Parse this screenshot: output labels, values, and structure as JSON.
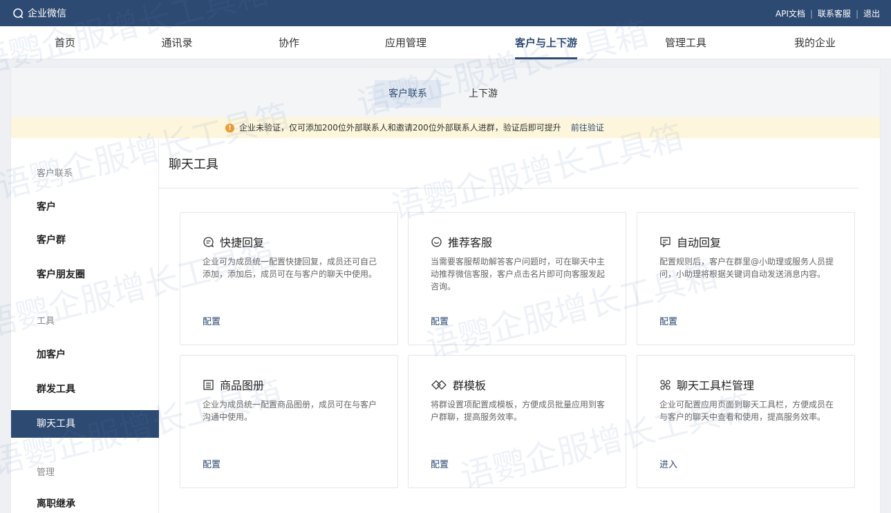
{
  "topbar": {
    "brand": "企业微信",
    "links": [
      "API文档",
      "联系客服",
      "退出"
    ],
    "separator": "|"
  },
  "nav": {
    "items": [
      "首页",
      "通讯录",
      "协作",
      "应用管理",
      "客户与上下游",
      "管理工具",
      "我的企业"
    ],
    "active_index": 4
  },
  "subtabs": {
    "items": [
      "客户联系",
      "上下游"
    ],
    "active_index": 0
  },
  "notice": {
    "icon": "warning-icon",
    "text": "企业未验证，仅可添加200位外部联系人和邀请200位外部联系人进群，验证后即可提升",
    "link": "前往验证"
  },
  "sidebar": {
    "groups": [
      {
        "label": "客户联系",
        "items": [
          "客户",
          "客户群",
          "客户朋友圈"
        ]
      },
      {
        "label": "工具",
        "items": [
          "加客户",
          "群发工具",
          "聊天工具"
        ]
      },
      {
        "label": "管理",
        "items": [
          "离职继承"
        ]
      }
    ],
    "active_item": "聊天工具"
  },
  "content": {
    "title": "聊天工具",
    "cards": [
      {
        "icon": "quick-reply-icon",
        "title": "快捷回复",
        "desc": "企业可为成员统一配置快捷回复，成员还可自己添加，添加后，成员可在与客户的聊天中使用。",
        "action": "配置"
      },
      {
        "icon": "recommend-service-icon",
        "title": "推荐客服",
        "desc": "当需要客服帮助解答客户问题时，可在聊天中主动推荐微信客服，客户点击名片即可向客服发起咨询。",
        "action": "配置"
      },
      {
        "icon": "auto-reply-icon",
        "title": "自动回复",
        "desc": "配置规则后，客户在群里@小助理或服务人员提问，小助理将根据关键词自动发送消息内容。",
        "action": "配置"
      },
      {
        "icon": "product-album-icon",
        "title": "商品图册",
        "desc": "企业为成员统一配置商品图册，成员可在与客户沟通中使用。",
        "action": "配置"
      },
      {
        "icon": "group-template-icon",
        "title": "群模板",
        "desc": "将群设置项配置成模板，方便成员批量应用到客户群聊，提高服务效率。",
        "action": "配置"
      },
      {
        "icon": "toolbar-manage-icon",
        "title": "聊天工具栏管理",
        "desc": "企业可配置应用页面到聊天工具栏，方便成员在与客户的聊天中查看和使用，提高服务效率。",
        "action": "进入"
      }
    ]
  },
  "watermark_text": "语鹦企服增长工具箱",
  "colors": {
    "brand": "#2d4a72",
    "notice_bg": "#fdf6dc",
    "warning": "#f29b2f"
  }
}
